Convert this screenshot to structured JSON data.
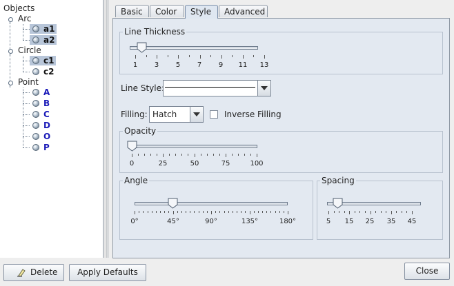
{
  "tree": {
    "root_label": "Objects",
    "groups": [
      {
        "label": "Arc",
        "items": [
          {
            "label": "a1",
            "selected": true,
            "color": "#111111"
          },
          {
            "label": "a2",
            "selected": true,
            "color": "#111111"
          }
        ]
      },
      {
        "label": "Circle",
        "items": [
          {
            "label": "c1",
            "selected": true,
            "color": "#111111"
          },
          {
            "label": "c2",
            "selected": false,
            "color": "#111111"
          }
        ]
      },
      {
        "label": "Point",
        "items": [
          {
            "label": "A",
            "selected": false,
            "color": "#1a1ab8"
          },
          {
            "label": "B",
            "selected": false,
            "color": "#1a1ab8"
          },
          {
            "label": "C",
            "selected": false,
            "color": "#1a1ab8"
          },
          {
            "label": "D",
            "selected": false,
            "color": "#1a1ab8"
          },
          {
            "label": "O",
            "selected": false,
            "color": "#1a1ab8"
          },
          {
            "label": "P",
            "selected": false,
            "color": "#1a1ab8"
          }
        ]
      }
    ]
  },
  "tabs": [
    {
      "label": "Basic",
      "active": false
    },
    {
      "label": "Color",
      "active": false
    },
    {
      "label": "Style",
      "active": true
    },
    {
      "label": "Advanced",
      "active": false
    }
  ],
  "style": {
    "line_thickness": {
      "title": "Line Thickness",
      "value": 2,
      "min": 1,
      "max": 13,
      "tick_labels": [
        "1",
        "3",
        "5",
        "7",
        "9",
        "11",
        "13"
      ]
    },
    "line_style": {
      "label": "Line Style:",
      "selected": "solid"
    },
    "filling": {
      "label": "Filling:",
      "selected": "Hatch"
    },
    "inverse_filling": {
      "label": "Inverse Filling",
      "checked": false
    },
    "opacity": {
      "title": "Opacity",
      "value": 0,
      "min": 0,
      "max": 100,
      "tick_labels": [
        "0",
        "25",
        "50",
        "75",
        "100"
      ]
    },
    "angle": {
      "title": "Angle",
      "value": 45,
      "min": 0,
      "max": 180,
      "tick_labels": [
        "0°",
        "45°",
        "90°",
        "135°",
        "180°"
      ]
    },
    "spacing": {
      "title": "Spacing",
      "value": 10,
      "min": 5,
      "max": 50,
      "tick_labels": [
        "5",
        "15",
        "25",
        "35",
        "45"
      ]
    }
  },
  "buttons": {
    "delete": "Delete",
    "apply_defaults": "Apply Defaults",
    "close": "Close"
  }
}
